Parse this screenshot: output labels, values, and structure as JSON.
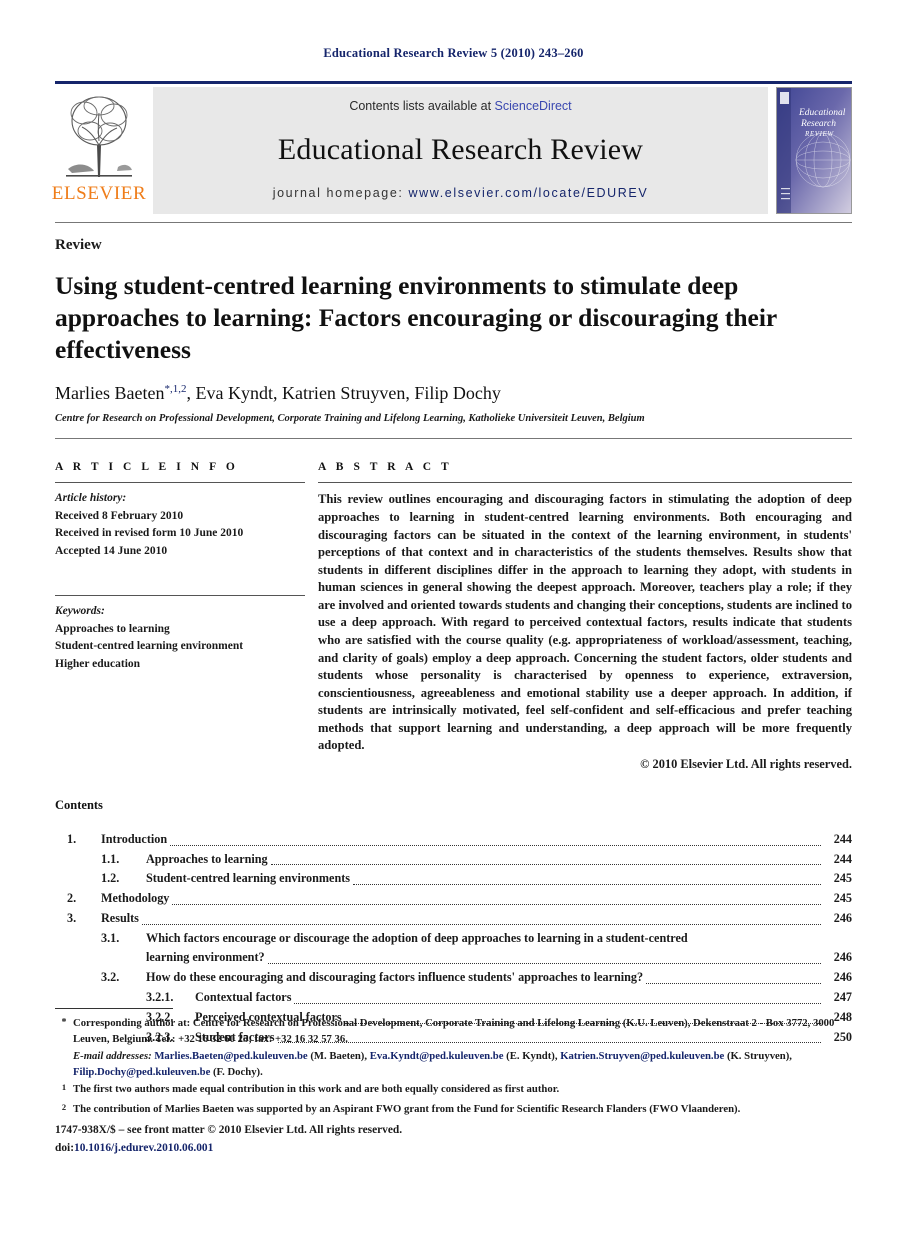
{
  "running_head": "Educational Research Review 5 (2010) 243–260",
  "masthead": {
    "contents_available_prefix": "Contents lists available at ",
    "sciencedirect": "ScienceDirect",
    "journal_title": "Educational Research Review",
    "homepage_label": "journal homepage: ",
    "homepage_url": "www.elsevier.com/locate/EDUREV",
    "publisher": "ELSEVIER",
    "cover_line1": "Educational",
    "cover_line2": "Research",
    "cover_line3": "REVIEW",
    "accent_orange": "#ef7d1a",
    "accent_navy": "#15256b",
    "link_blue": "#3a48b0"
  },
  "article": {
    "type": "Review",
    "title": "Using student-centred learning environments to stimulate deep approaches to learning: Factors encouraging or discouraging their effectiveness",
    "authors_plain": "Marlies Baeten",
    "authors_marks": "*,1,2",
    "authors_rest": ", Eva Kyndt, Katrien Struyven, Filip Dochy",
    "affiliation": "Centre for Research on Professional Development, Corporate Training and Lifelong Learning, Katholieke Universiteit Leuven, Belgium"
  },
  "article_info": {
    "heading": "A R T I C L E   I N F O",
    "history_label": "Article history:",
    "history": [
      "Received 8 February 2010",
      "Received in revised form 10 June 2010",
      "Accepted 14 June 2010"
    ],
    "keywords_label": "Keywords:",
    "keywords": [
      "Approaches to learning",
      "Student-centred learning environment",
      "Higher education"
    ]
  },
  "abstract": {
    "heading": "A B S T R A C T",
    "text": "This review outlines encouraging and discouraging factors in stimulating the adoption of deep approaches to learning in student-centred learning environments. Both encouraging and discouraging factors can be situated in the context of the learning environment, in students' perceptions of that context and in characteristics of the students themselves. Results show that students in different disciplines differ in the approach to learning they adopt, with students in human sciences in general showing the deepest approach. Moreover, teachers play a role; if they are involved and oriented towards students and changing their conceptions, students are inclined to use a deep approach. With regard to perceived contextual factors, results indicate that students who are satisfied with the course quality (e.g. appropriateness of workload/assessment, teaching, and clarity of goals) employ a deep approach. Concerning the student factors, older students and students whose personality is characterised by openness to experience, extraversion, conscientiousness, agreeableness and emotional stability use a deeper approach. In addition, if students are intrinsically motivated, feel self-confident and self-efficacious and prefer teaching methods that support learning and understanding, a deep approach will be more frequently adopted.",
    "copyright": "© 2010 Elsevier Ltd. All rights reserved."
  },
  "contents": {
    "title": "Contents",
    "entries": [
      {
        "level": 1,
        "num": "1.",
        "label": "Introduction",
        "page": "244"
      },
      {
        "level": 2,
        "num": "1.1.",
        "label": "Approaches to learning",
        "page": "244"
      },
      {
        "level": 2,
        "num": "1.2.",
        "label": "Student-centred learning environments",
        "page": "245"
      },
      {
        "level": 1,
        "num": "2.",
        "label": "Methodology",
        "page": "245"
      },
      {
        "level": 1,
        "num": "3.",
        "label": "Results",
        "page": "246"
      },
      {
        "level": 2,
        "num": "3.1.",
        "label": "Which factors encourage or discourage the adoption of deep approaches to learning in a student-centred",
        "label2": "learning environment?",
        "page": "246",
        "wrap": true
      },
      {
        "level": 2,
        "num": "3.2.",
        "label": "How do these encouraging and discouraging factors influence students' approaches to learning?",
        "page": "246"
      },
      {
        "level": 3,
        "num": "3.2.1.",
        "label": "Contextual factors",
        "page": "247"
      },
      {
        "level": 3,
        "num": "3.2.2.",
        "label": "Perceived contextual factors",
        "page": "248"
      },
      {
        "level": 3,
        "num": "3.2.3.",
        "label": "Student factors",
        "page": "250"
      }
    ]
  },
  "footnotes": {
    "corresponding_mark": "*",
    "corresponding": "Corresponding author at: Centre for Research on Professional Development, Corporate Training and Lifelong Learning (K.U. Leuven), Dekenstraat 2 - Box 3772, 3000 Leuven, Belgium. Tel.: +32 16 32 60 25; fax: +32 16 32 57 36.",
    "email_label": "E-mail addresses:",
    "emails": [
      {
        "address": "Marlies.Baeten@ped.kuleuven.be",
        "person": " (M. Baeten), "
      },
      {
        "address": "Eva.Kyndt@ped.kuleuven.be",
        "person": " (E. Kyndt), "
      },
      {
        "address": "Katrien.Struyven@ped.kuleuven.be",
        "person": " (K. Struyven), "
      },
      {
        "address": "Filip.Dochy@ped.kuleuven.be",
        "person": " (F. Dochy)."
      }
    ],
    "note1_mark": "1",
    "note1": "The first two authors made equal contribution in this work and are both equally considered as first author.",
    "note2_mark": "2",
    "note2": "The contribution of Marlies Baeten was supported by an Aspirant FWO grant from the Fund for Scientific Research Flanders (FWO Vlaanderen)."
  },
  "imprint": {
    "issn_line": "1747-938X/$ – see front matter © 2010 Elsevier Ltd. All rights reserved.",
    "doi_label": "doi:",
    "doi_value": "10.1016/j.edurev.2010.06.001"
  }
}
